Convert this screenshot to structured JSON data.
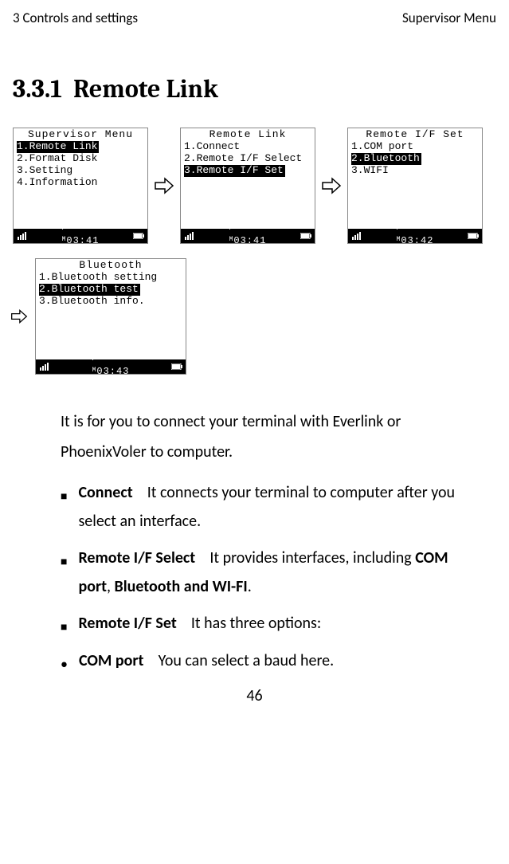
{
  "header": {
    "left": "3 Controls and settings",
    "right": "Supervisor Menu"
  },
  "section_number": "3.3.1",
  "section_title": "Remote Link",
  "screens": {
    "supervisor": {
      "title": "Supervisor Menu",
      "items": [
        "1.Remote Link",
        "2.Format Disk",
        "3.Setting",
        "4.Information"
      ],
      "selected_index": 0,
      "time": "03:41"
    },
    "remote_link": {
      "title": "Remote Link",
      "items": [
        "1.Connect",
        "2.Remote I/F Select",
        "3.Remote I/F Set"
      ],
      "selected_index": 2,
      "time": "03:41"
    },
    "remote_if_set": {
      "title": "Remote I/F Set",
      "items": [
        "1.COM port",
        "2.Bluetooth",
        "3.WIFI"
      ],
      "selected_index": 1,
      "time": "03:42"
    },
    "bluetooth": {
      "title": "Bluetooth",
      "items": [
        "1.Bluetooth setting",
        "2.Bluetooth test",
        "3.Bluetooth info."
      ],
      "selected_index": 1,
      "time": "03:43"
    }
  },
  "intro_para": "It is for you to connect your terminal with Everlink or PhoenixVoler to computer.",
  "bullets": [
    {
      "label": "Connect",
      "text": "It connects your terminal to computer after you select an interface."
    },
    {
      "label": "Remote I/F Select",
      "text": "It provides interfaces, including ",
      "bold_tail": "COM port",
      "after_bold": ", ",
      "bold_tail2": "Bluetooth and WI-FI",
      "after_bold2": "."
    },
    {
      "label": "Remote I/F Set",
      "text": "It has three options:"
    }
  ],
  "sub_bullets": [
    {
      "label": "COM port",
      "text": "You can select a baud here."
    }
  ],
  "page_number": "46"
}
